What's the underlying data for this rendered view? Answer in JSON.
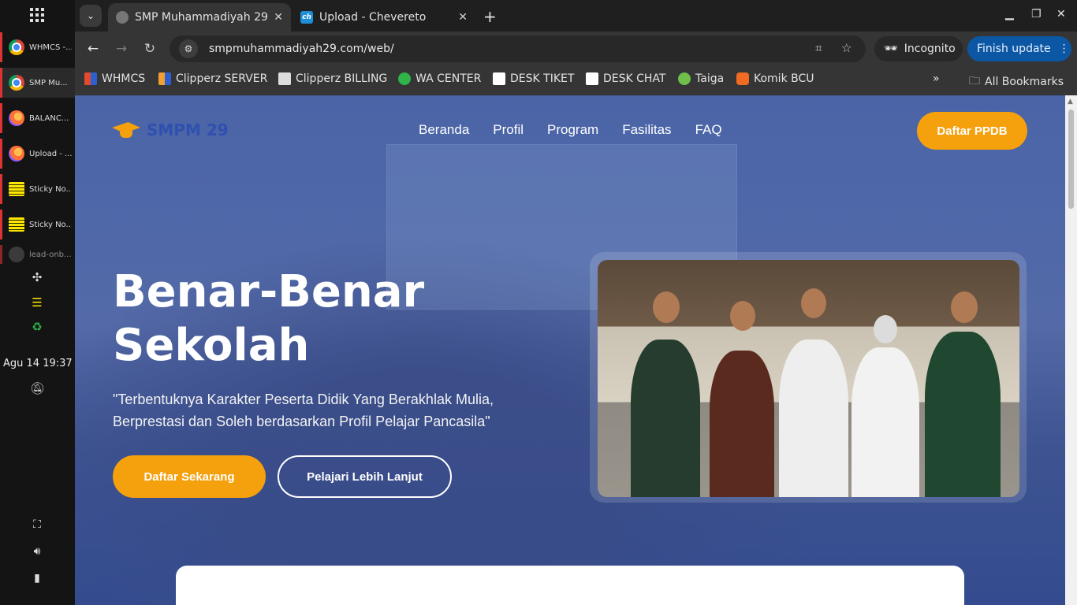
{
  "dock": {
    "items": [
      {
        "label": "WHMCS -...",
        "icon": "chrome-icon"
      },
      {
        "label": "SMP Mu...",
        "icon": "chrome-icon"
      },
      {
        "label": "BALANC...",
        "icon": "firefox-icon"
      },
      {
        "label": "Upload - ...",
        "icon": "firefox-icon"
      },
      {
        "label": "Sticky No...",
        "icon": "sticky-notes-icon"
      },
      {
        "label": "Sticky No...",
        "icon": "sticky-notes-icon"
      },
      {
        "label": "lead-onb...",
        "icon": "app-icon"
      }
    ],
    "clock": "Agu 14  19:37"
  },
  "browser": {
    "tabs": [
      {
        "title": "SMP Muhammadiyah 29",
        "active": true
      },
      {
        "title": "Upload - Chevereto",
        "active": false
      }
    ],
    "favicon_ch": "ch",
    "url": "smpmuhammadiyah29.com/web/",
    "incognito_label": "Incognito",
    "update_label": "Finish update",
    "bookmarks": [
      {
        "label": "WHMCS",
        "color": "#e04a2f"
      },
      {
        "label": "Clipperz SERVER",
        "color": "#f0a030"
      },
      {
        "label": "Clipperz BILLING",
        "color": "#dddddd"
      },
      {
        "label": "WA CENTER",
        "color": "#2fb34a"
      },
      {
        "label": "DESK TIKET",
        "color": "#ffffff"
      },
      {
        "label": "DESK CHAT",
        "color": "#ffffff"
      },
      {
        "label": "Taiga",
        "color": "#6fbf4a"
      },
      {
        "label": "Komik BCU",
        "color": "#f26b22"
      }
    ],
    "all_bookmarks": "All Bookmarks"
  },
  "site": {
    "logo_text": "SMPM 29",
    "nav": [
      "Beranda",
      "Profil",
      "Program",
      "Fasilitas",
      "FAQ"
    ],
    "ppdb_button": "Daftar PPDB",
    "headline_line1": "Benar-Benar",
    "headline_line2": "Sekolah",
    "quote": "\"Terbentuknya Karakter Peserta Didik Yang Berakhlak Mulia, Berprestasi dan Soleh berdasarkan Profil Pelajar Pancasila\"",
    "cta_primary": "Daftar Sekarang",
    "cta_secondary": "Pelajari Lebih Lanjut",
    "accent": "#f5a00d",
    "overlay": "#2b4aa0"
  }
}
